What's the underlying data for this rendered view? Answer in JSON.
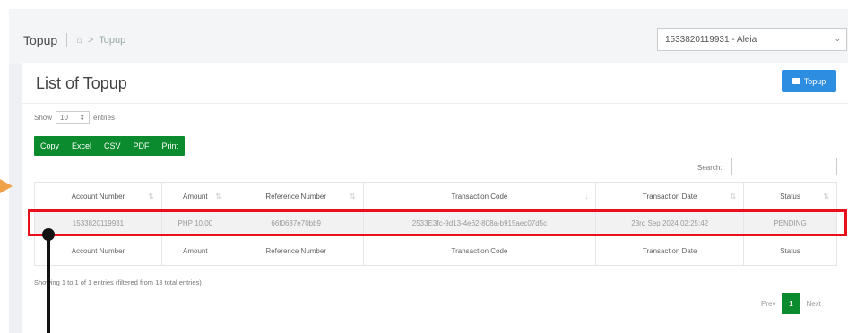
{
  "header": {
    "title": "Topup",
    "breadcrumb_current": "Topup",
    "account_select_value": "1533820119931 - Aleia"
  },
  "card": {
    "title": "List of Topup",
    "topup_button": "Topup"
  },
  "length_menu": {
    "prefix": "Show",
    "value": "10",
    "suffix": "entries"
  },
  "export_buttons": [
    "Copy",
    "Excel",
    "CSV",
    "PDF",
    "Print"
  ],
  "search": {
    "label": "Search:"
  },
  "table": {
    "columns": [
      "Account Number",
      "Amount",
      "Reference Number",
      "Transaction Code",
      "Transaction Date",
      "Status"
    ],
    "rows": [
      [
        "1533820119931",
        "PHP 10.00",
        "66f0637e70bb9",
        "2533E3fc-9d13-4e62-808a-b915aec07d5c",
        "23rd Sep 2024 02:25:42",
        "PENDING"
      ]
    ]
  },
  "info_text": "Showing 1 to 1 of 1 entries (filtered from 13 total entries)",
  "pagination": {
    "prev": "Prev",
    "current": "1",
    "next": "Next"
  },
  "colors": {
    "highlight": "#e8101a",
    "export_green": "#0b8a2e",
    "topup_blue": "#2d8de0",
    "arrow": "#f0a14a"
  }
}
